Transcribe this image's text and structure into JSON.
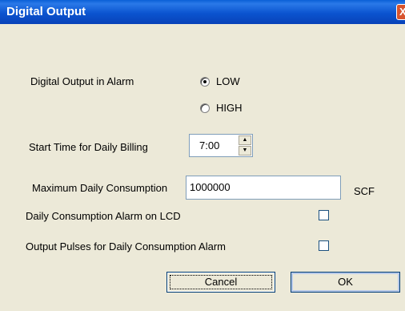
{
  "window": {
    "title": "Digital Output",
    "close_glyph": "X"
  },
  "digital_output": {
    "label": "Digital Output in Alarm",
    "options": [
      {
        "label": "LOW",
        "checked": true
      },
      {
        "label": "HIGH",
        "checked": false
      }
    ]
  },
  "start_time": {
    "label": "Start Time for Daily Billing",
    "value": "7:00"
  },
  "max_consumption": {
    "label": "Maximum Daily Consumption",
    "value": "1000000",
    "unit": "SCF"
  },
  "lcd_alarm": {
    "label": "Daily Consumption Alarm on LCD",
    "checked": false
  },
  "output_pulses": {
    "label": "Output Pulses for Daily Consumption Alarm",
    "checked": false
  },
  "buttons": {
    "cancel_label": "Cancel",
    "ok_label": "OK"
  },
  "colors": {
    "title_bar": "#0B54D0",
    "dialog_bg": "#ECE9D8",
    "close_button": "#D8542E"
  }
}
